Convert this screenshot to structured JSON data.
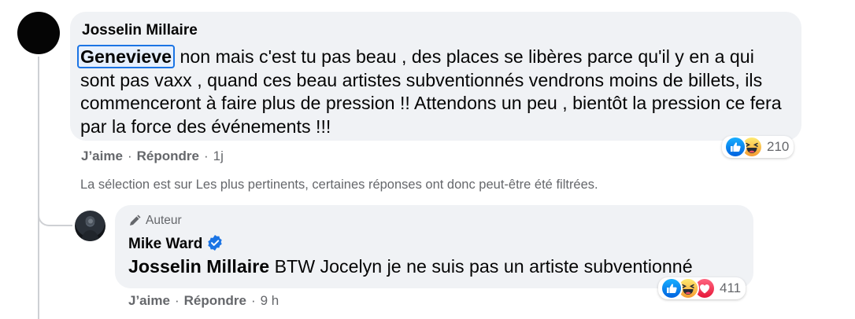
{
  "comment": {
    "author": "Josselin Millaire",
    "mention": "Genevieve",
    "text": " non mais c'est tu pas beau , des places se libères parce qu'il y en a qui sont pas vaxx , quand ces beau artistes subventionnés vendrons moins de billets, ils commenceront à faire plus de pression !! Attendons un peu , bientôt la pression ce fera par la force des événements !!!",
    "actions": {
      "like": "J’aime",
      "reply": "Répondre",
      "time": "1j"
    },
    "reactions": {
      "icons": [
        "like-icon",
        "haha-icon"
      ],
      "count": "210"
    }
  },
  "filter_note": "La sélection est sur Les plus pertinents, certaines réponses ont donc peut-être été filtrées.",
  "reply": {
    "badge": "Auteur",
    "author": "Mike Ward",
    "mention": "Josselin Millaire",
    "text": " BTW Jocelyn je ne suis pas un artiste subventionné",
    "actions": {
      "like": "J’aime",
      "reply": "Répondre",
      "time": "9 h"
    },
    "reactions": {
      "icons": [
        "like-icon",
        "haha-icon",
        "love-icon"
      ],
      "count": "411"
    }
  },
  "colors": {
    "bubble": "#f0f2f5",
    "accent": "#1b74e4",
    "secondary_text": "#65676b"
  }
}
